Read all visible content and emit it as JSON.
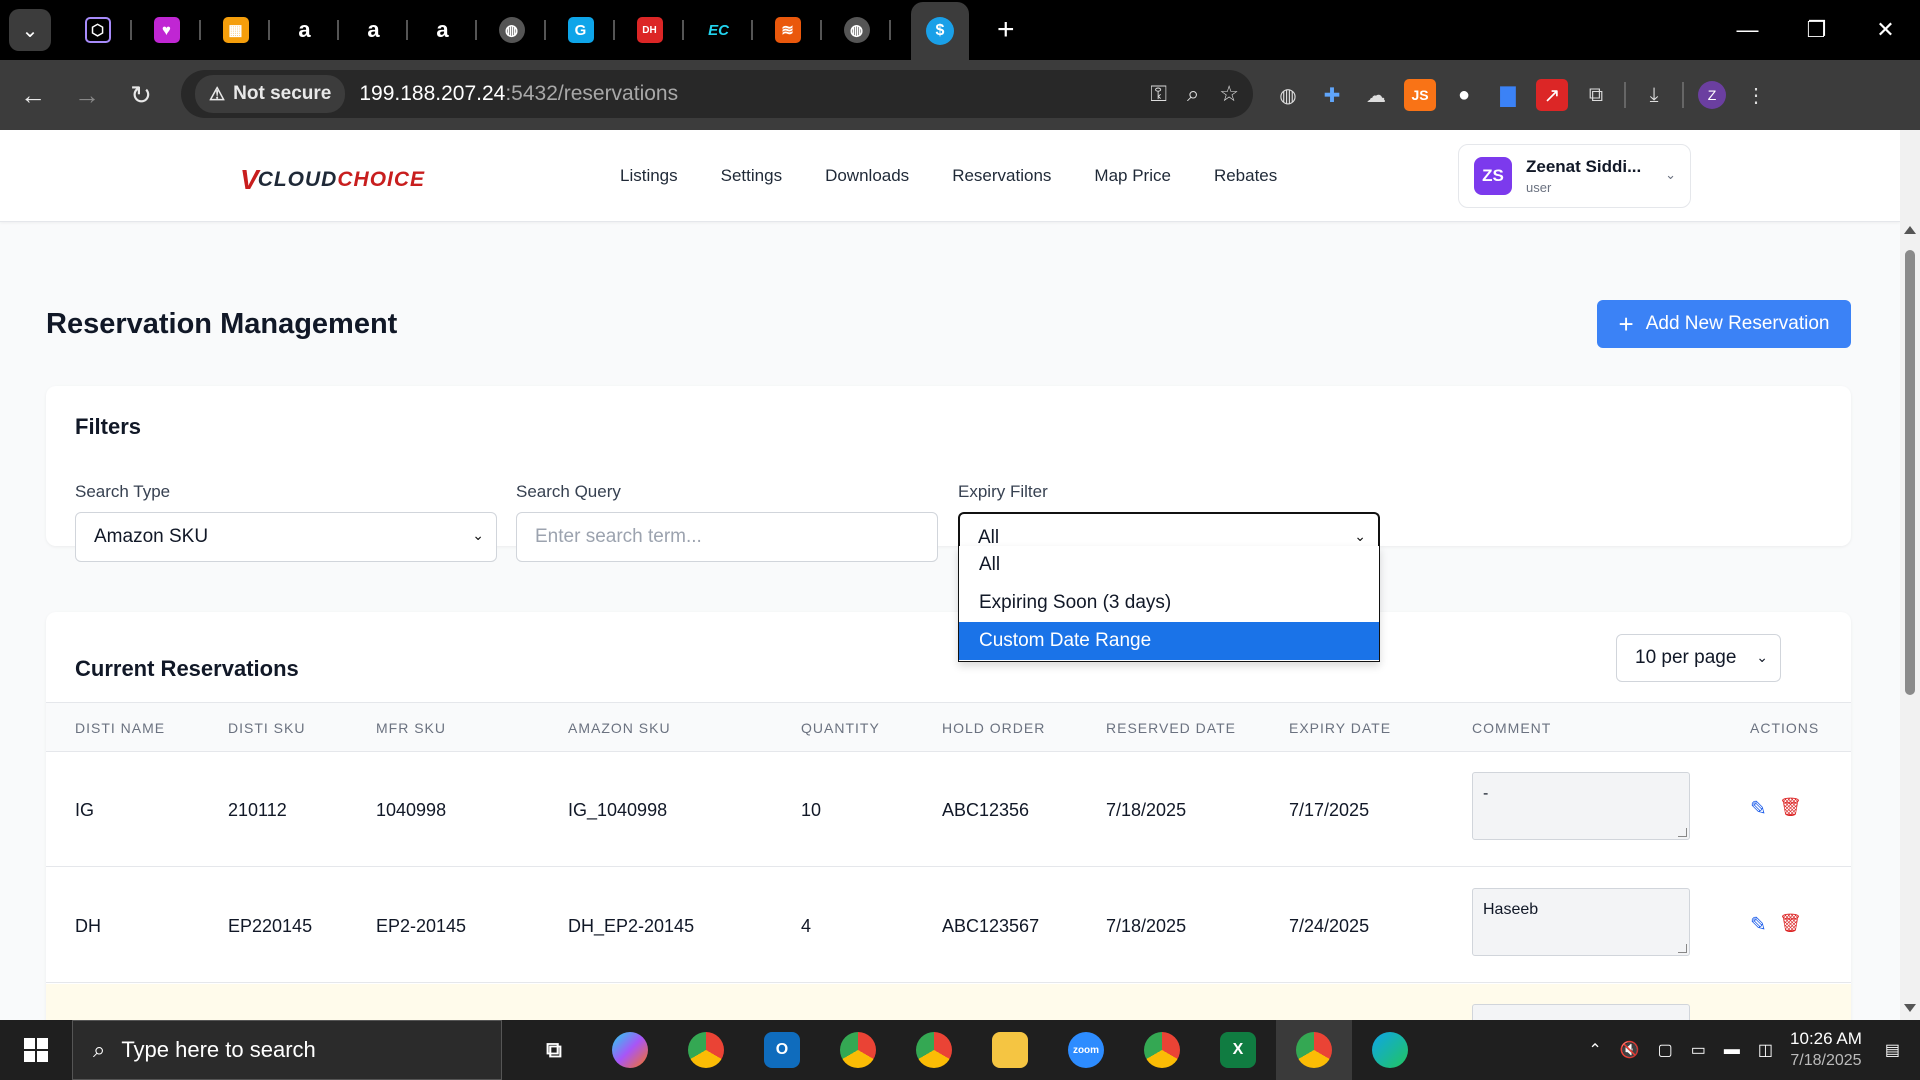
{
  "browser": {
    "url_host": "199.188.207.24",
    "url_path": ":5432/reservations",
    "security_label": "Not secure"
  },
  "header": {
    "logo_v": "V",
    "logo_cloud": "CLOUD",
    "logo_choice": "CHOICE",
    "nav": [
      "Listings",
      "Settings",
      "Downloads",
      "Reservations",
      "Map Price",
      "Rebates"
    ],
    "user": {
      "initials": "ZS",
      "name": "Zeenat Siddi...",
      "role": "user"
    }
  },
  "page": {
    "title": "Reservation Management",
    "add_button": "Add New Reservation"
  },
  "filters": {
    "title": "Filters",
    "search_type_label": "Search Type",
    "search_type_value": "Amazon SKU",
    "search_query_label": "Search Query",
    "search_query_placeholder": "Enter search term...",
    "expiry_label": "Expiry Filter",
    "expiry_value": "All",
    "expiry_options": [
      "All",
      "Expiring Soon (3 days)",
      "Custom Date Range"
    ],
    "expiry_highlighted": "Custom Date Range"
  },
  "reservations": {
    "title": "Current Reservations",
    "per_page": "10 per page",
    "columns": [
      "DISTI NAME",
      "DISTI SKU",
      "MFR SKU",
      "AMAZON SKU",
      "QUANTITY",
      "HOLD ORDER",
      "RESERVED DATE",
      "EXPIRY DATE",
      "COMMENT",
      "ACTIONS"
    ],
    "rows": [
      {
        "disti_name": "IG",
        "disti_sku": "210112",
        "mfr_sku": "1040998",
        "amazon_sku": "IG_1040998",
        "quantity": "10",
        "hold_order": "ABC12356",
        "reserved_date": "7/18/2025",
        "expiry_date": "7/17/2025",
        "comment": "-"
      },
      {
        "disti_name": "DH",
        "disti_sku": "EP220145",
        "mfr_sku": "EP2-20145",
        "amazon_sku": "DH_EP2-20145",
        "quantity": "4",
        "hold_order": "ABC123567",
        "reserved_date": "7/18/2025",
        "expiry_date": "7/24/2025",
        "comment": "Haseeb"
      }
    ]
  },
  "taskbar": {
    "search_placeholder": "Type here to search",
    "time": "10:26 AM",
    "date": "7/18/2025"
  },
  "colors": {
    "accent": "#3b82f6",
    "brand_red": "#c81e1e",
    "avatar": "#7c3aed",
    "option_highlight": "#1a73e8"
  }
}
